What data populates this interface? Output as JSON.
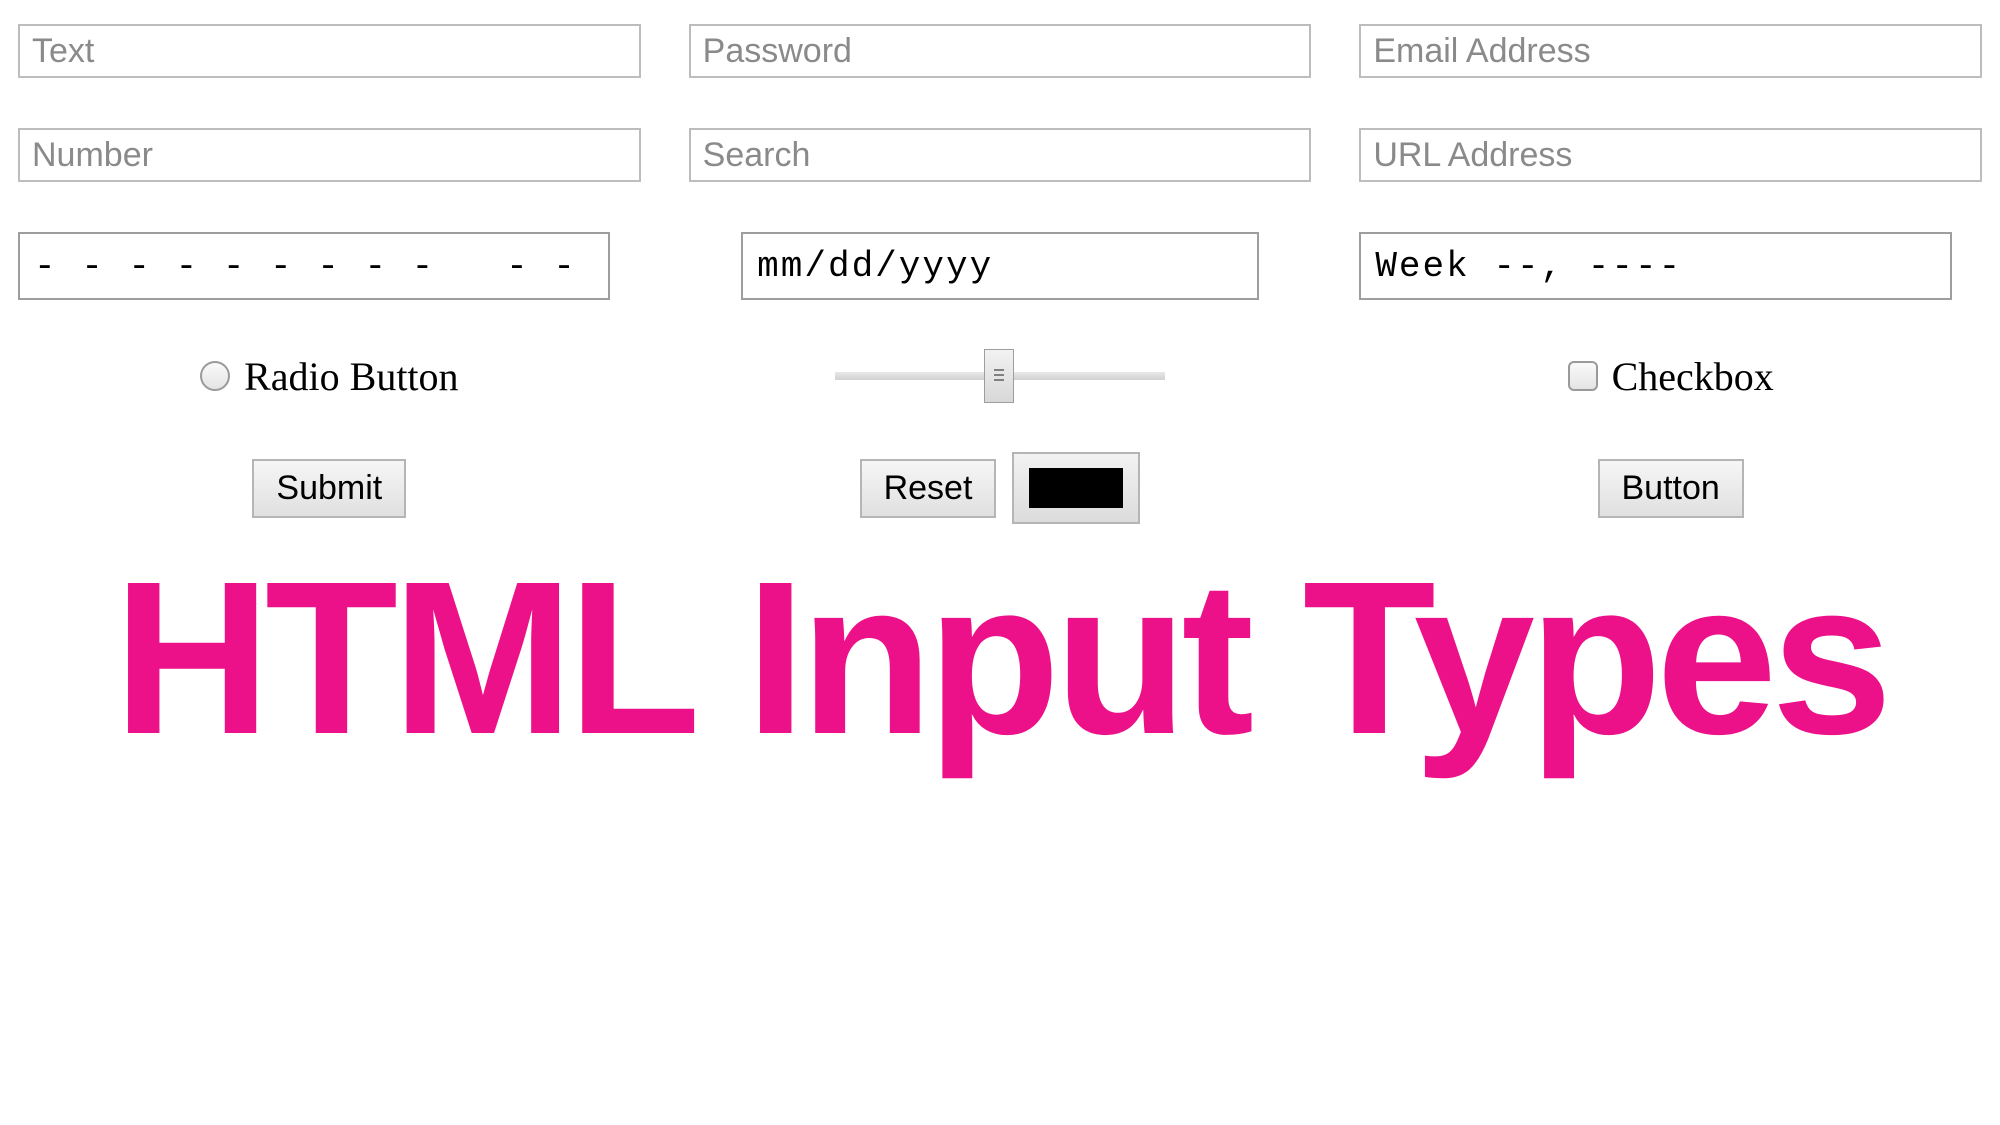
{
  "inputs": {
    "text": {
      "placeholder": "Text"
    },
    "password": {
      "placeholder": "Password"
    },
    "email": {
      "placeholder": "Email Address"
    },
    "number": {
      "placeholder": "Number"
    },
    "search": {
      "placeholder": "Search"
    },
    "url": {
      "placeholder": "URL Address"
    },
    "tel": {
      "placeholder": "- - - - - - - - -   - - - -"
    },
    "date": {
      "placeholder": "mm/dd/yyyy"
    },
    "week": {
      "placeholder": "Week --, ----"
    }
  },
  "radio": {
    "label": "Radio Button"
  },
  "checkbox": {
    "label": "Checkbox"
  },
  "slider": {
    "value": 50,
    "min": 0,
    "max": 100
  },
  "buttons": {
    "submit": "Submit",
    "reset": "Reset",
    "button": "Button"
  },
  "color": {
    "value": "#000000"
  },
  "title": "HTML Input Types"
}
